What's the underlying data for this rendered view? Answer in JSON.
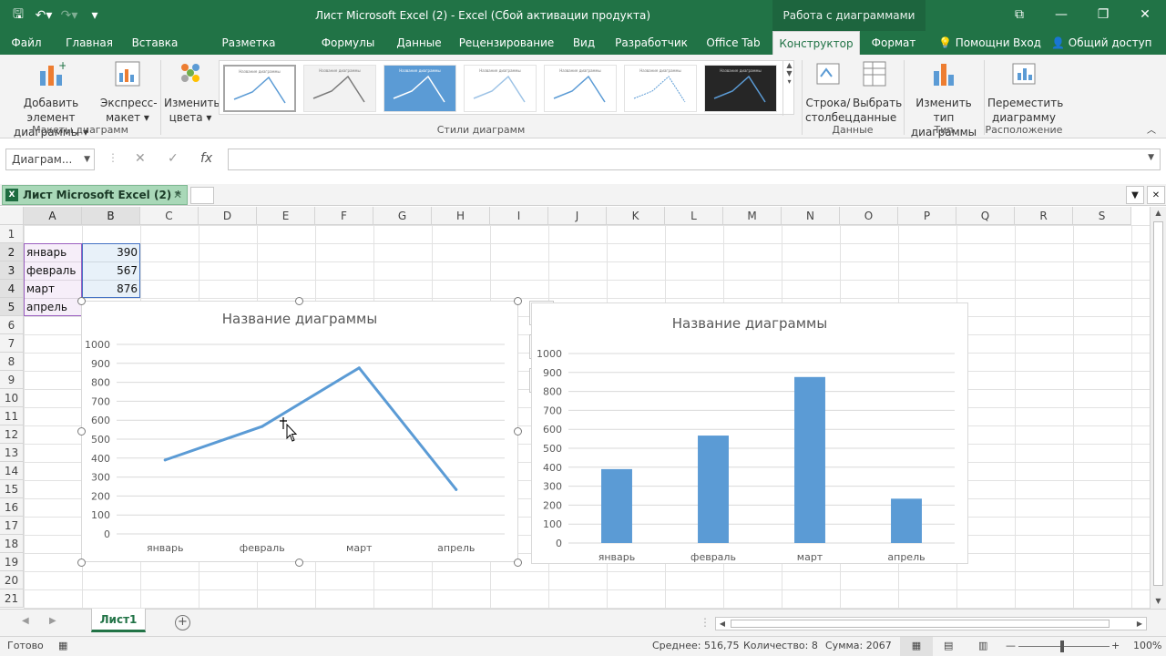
{
  "window": {
    "title": "Лист Microsoft Excel (2) - Excel (Сбой активации продукта)",
    "context_group": "Работа с диаграммами"
  },
  "tabs": [
    "Файл",
    "Главная",
    "Вставка",
    "Разметка страницы",
    "Формулы",
    "Данные",
    "Рецензирование",
    "Вид",
    "Разработчик",
    "Office Tab",
    "Конструктор",
    "Формат"
  ],
  "tabs_right": {
    "help": "Помощни",
    "signin": "Вход",
    "share": "Общий доступ"
  },
  "ribbon": {
    "add_element": [
      "Добавить элемент",
      "диаграммы ▾"
    ],
    "express_layout": [
      "Экспресс-",
      "макет ▾"
    ],
    "change_colors": [
      "Изменить",
      "цвета ▾"
    ],
    "group_layouts": "Макеты диаграмм",
    "group_styles": "Стили диаграмм",
    "gallery_titles": [
      "Название диаграммы",
      "Название диаграммы",
      "Название диаграммы",
      "Название диаграммы",
      "Название диаграммы",
      "Название диаграммы",
      "Название диаграммы"
    ],
    "row_col": [
      "Строка/",
      "столбец"
    ],
    "select_data": [
      "Выбрать",
      "данные"
    ],
    "group_data": "Данные",
    "change_type": [
      "Изменить тип",
      "диаграммы"
    ],
    "group_type": "Тип",
    "move_chart": [
      "Переместить",
      "диаграмму"
    ],
    "group_location": "Расположение"
  },
  "namebox": "Диаграм...",
  "doc_tab": "Лист Microsoft Excel  (2) *",
  "columns": [
    "A",
    "B",
    "C",
    "D",
    "E",
    "F",
    "G",
    "H",
    "I",
    "J",
    "K",
    "L",
    "M",
    "N",
    "O",
    "P",
    "Q",
    "R",
    "S"
  ],
  "rows": [
    "1",
    "2",
    "3",
    "4",
    "5",
    "6",
    "7",
    "8",
    "9",
    "10",
    "11",
    "12",
    "13",
    "14",
    "15",
    "16",
    "17",
    "18",
    "19",
    "20",
    "21"
  ],
  "cells": [
    {
      "label": "январь",
      "value": "390"
    },
    {
      "label": "февраль",
      "value": "567"
    },
    {
      "label": "март",
      "value": "876"
    },
    {
      "label": "апрель",
      "value": ""
    }
  ],
  "chart_data": [
    {
      "type": "line",
      "title": "Название диаграммы",
      "categories": [
        "январь",
        "февраль",
        "март",
        "апрель"
      ],
      "values": [
        390,
        567,
        876,
        234
      ],
      "y_ticks": [
        "0",
        "100",
        "200",
        "300",
        "400",
        "500",
        "600",
        "700",
        "800",
        "900",
        "1000"
      ],
      "ylim": [
        0,
        1000
      ],
      "color": "#5b9bd5",
      "grid": true
    },
    {
      "type": "bar",
      "title": "Название диаграммы",
      "categories": [
        "январь",
        "февраль",
        "март",
        "апрель"
      ],
      "values": [
        390,
        567,
        876,
        234
      ],
      "y_ticks": [
        "0",
        "100",
        "200",
        "300",
        "400",
        "500",
        "600",
        "700",
        "800",
        "900",
        "1000"
      ],
      "ylim": [
        0,
        1000
      ],
      "color": "#5b9bd5",
      "grid": true
    }
  ],
  "sheet_tab": "Лист1",
  "status": {
    "ready": "Готово",
    "average": "Среднее: 516,75",
    "count": "Количество: 8",
    "sum": "Сумма: 2067",
    "zoom": "100%"
  },
  "colors": {
    "accent": "#217346",
    "series": "#5b9bd5"
  }
}
